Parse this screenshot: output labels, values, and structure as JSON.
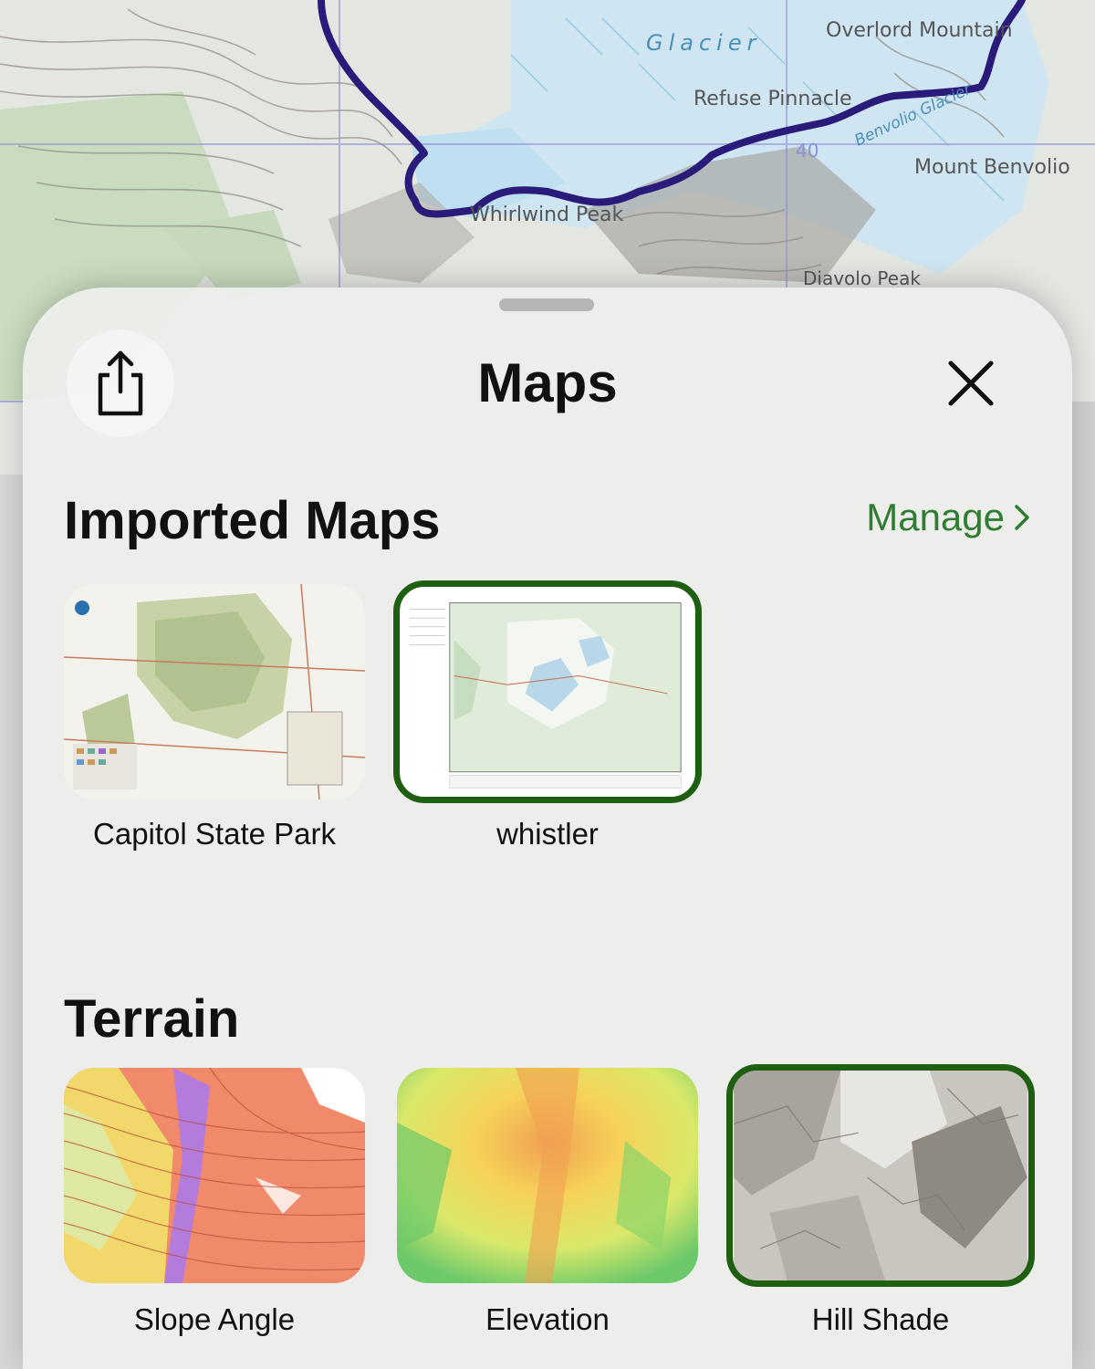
{
  "background_map": {
    "labels": [
      "Glacier",
      "Overlord Mountain",
      "Refuse Pinnacle",
      "Whirlwind Peak",
      "Mount Benvolio",
      "Benvolio Glacier",
      "Diavolo Peak",
      "40"
    ]
  },
  "sheet": {
    "title": "Maps",
    "share_icon": "share-icon",
    "close_icon": "close-icon"
  },
  "imported": {
    "heading": "Imported Maps",
    "manage_label": "Manage",
    "items": [
      {
        "label": "Capitol State Park",
        "selected": false
      },
      {
        "label": "whistler",
        "selected": true
      }
    ]
  },
  "terrain": {
    "heading": "Terrain",
    "items": [
      {
        "label": "Slope Angle",
        "selected": false
      },
      {
        "label": "Elevation",
        "selected": false
      },
      {
        "label": "Hill Shade",
        "selected": true
      }
    ]
  },
  "colors": {
    "accent_green": "#2e7d32",
    "selection_border": "#1f5f12",
    "route_line": "#2a1a7a"
  }
}
